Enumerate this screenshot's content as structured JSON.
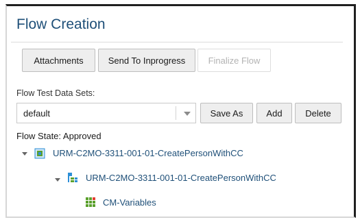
{
  "panel": {
    "title": "Flow Creation"
  },
  "toolbar": {
    "attachments_label": "Attachments",
    "send_label": "Send To Inprogress",
    "finalize_label": "Finalize Flow"
  },
  "datasets": {
    "label": "Flow Test Data Sets:",
    "selected": "default",
    "save_as_label": "Save As",
    "add_label": "Add",
    "delete_label": "Delete"
  },
  "flow_state": "Flow State: Approved",
  "tree": {
    "root": {
      "label": "URM-C2MO-3311-001-01-CreatePersonWithCC",
      "icon": "flow-node-icon",
      "expanded": true
    },
    "child": {
      "label": "URM-C2MO-3311-001-01-CreatePersonWithCC",
      "icon": "component-tree-icon",
      "expanded": true
    },
    "leaf": {
      "label": "CM-Variables",
      "icon": "variables-grid-icon"
    }
  },
  "colors": {
    "title": "#1e4f78",
    "link": "#1e4f78",
    "accent_blue": "#2c8fd6",
    "accent_green": "#5aa02c"
  }
}
